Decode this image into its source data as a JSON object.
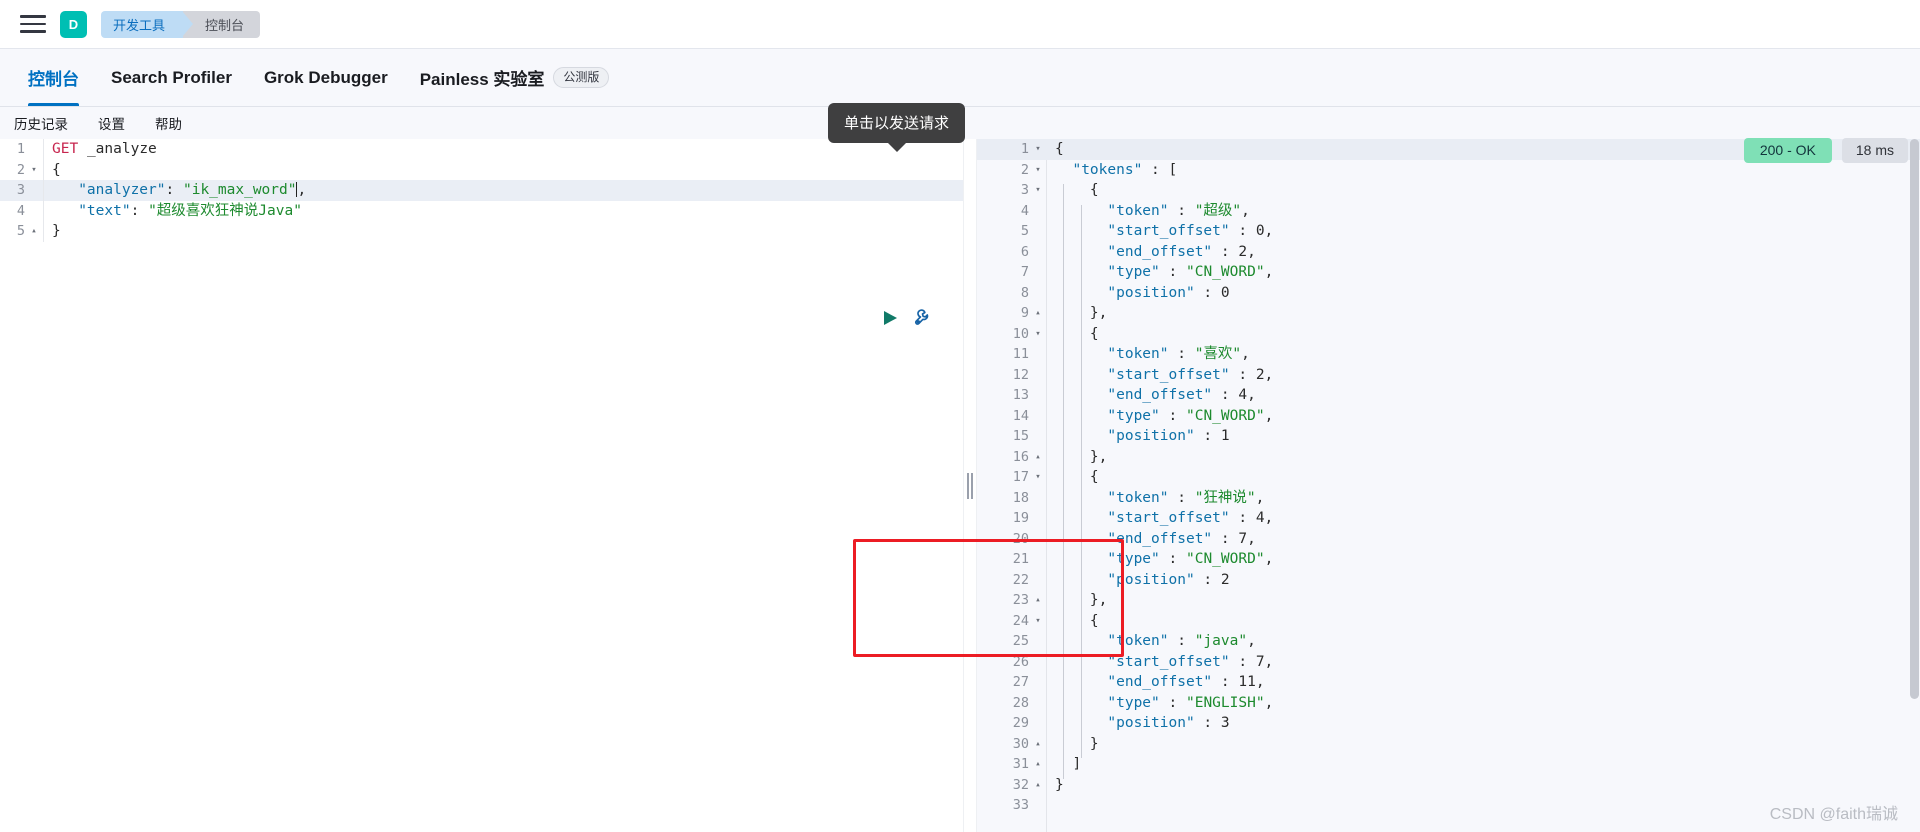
{
  "topbar": {
    "menu_icon": "hamburger-menu-icon",
    "avatar_letter": "D",
    "breadcrumb": {
      "first": "开发工具",
      "second": "控制台"
    }
  },
  "tabs": [
    {
      "label": "控制台",
      "active": true,
      "badge": ""
    },
    {
      "label": "Search Profiler",
      "active": false,
      "badge": ""
    },
    {
      "label": "Grok Debugger",
      "active": false,
      "badge": ""
    },
    {
      "label": "Painless 实验室",
      "active": false,
      "badge": "公测版"
    }
  ],
  "subnav": [
    {
      "label": "历史记录"
    },
    {
      "label": "设置"
    },
    {
      "label": "帮助"
    }
  ],
  "tooltip": {
    "text": "单击以发送请求"
  },
  "run_controls": {
    "play_icon": "play-triangle-icon",
    "wrench_icon": "wrench-icon",
    "play_color": "#117a68",
    "wrench_color": "#1763a6"
  },
  "status": {
    "code": "200 - OK",
    "time": "18 ms",
    "ok_color": "#7fe0b6",
    "time_color": "#dcdfe6"
  },
  "request_editor": {
    "highlight_line": 3,
    "lines": [
      {
        "n": 1,
        "fold": "",
        "tokens": [
          {
            "t": "method",
            "v": "GET"
          },
          {
            "t": "plain",
            "v": " "
          },
          {
            "t": "url",
            "v": "_analyze"
          }
        ]
      },
      {
        "n": 2,
        "fold": "▾",
        "tokens": [
          {
            "t": "punc",
            "v": "{"
          }
        ]
      },
      {
        "n": 3,
        "fold": "",
        "tokens": [
          {
            "t": "plain",
            "v": "   "
          },
          {
            "t": "key",
            "v": "\"analyzer\""
          },
          {
            "t": "punc",
            "v": ": "
          },
          {
            "t": "str",
            "v": "\"ik_max_word\""
          },
          {
            "t": "caret",
            "v": ""
          },
          {
            "t": "punc",
            "v": ","
          }
        ]
      },
      {
        "n": 4,
        "fold": "",
        "tokens": [
          {
            "t": "plain",
            "v": "   "
          },
          {
            "t": "key",
            "v": "\"text\""
          },
          {
            "t": "punc",
            "v": ": "
          },
          {
            "t": "str",
            "v": "\"超级喜欢狂神说Java\""
          }
        ]
      },
      {
        "n": 5,
        "fold": "▴",
        "tokens": [
          {
            "t": "punc",
            "v": "}"
          }
        ]
      }
    ]
  },
  "response_editor": {
    "lines": [
      {
        "n": 1,
        "fold": "▾",
        "indent": 0,
        "tokens": [
          {
            "t": "punc",
            "v": "{"
          }
        ]
      },
      {
        "n": 2,
        "fold": "▾",
        "indent": 0,
        "tokens": [
          {
            "t": "plain",
            "v": "  "
          },
          {
            "t": "key",
            "v": "\"tokens\""
          },
          {
            "t": "punc",
            "v": " : ["
          }
        ]
      },
      {
        "n": 3,
        "fold": "▾",
        "indent": 1,
        "tokens": [
          {
            "t": "plain",
            "v": "    "
          },
          {
            "t": "punc",
            "v": "{"
          }
        ]
      },
      {
        "n": 4,
        "fold": "",
        "indent": 2,
        "tokens": [
          {
            "t": "plain",
            "v": "      "
          },
          {
            "t": "key",
            "v": "\"token\""
          },
          {
            "t": "punc",
            "v": " : "
          },
          {
            "t": "str",
            "v": "\"超级\""
          },
          {
            "t": "punc",
            "v": ","
          }
        ]
      },
      {
        "n": 5,
        "fold": "",
        "indent": 2,
        "tokens": [
          {
            "t": "plain",
            "v": "      "
          },
          {
            "t": "key",
            "v": "\"start_offset\""
          },
          {
            "t": "punc",
            "v": " : "
          },
          {
            "t": "num",
            "v": "0"
          },
          {
            "t": "punc",
            "v": ","
          }
        ]
      },
      {
        "n": 6,
        "fold": "",
        "indent": 2,
        "tokens": [
          {
            "t": "plain",
            "v": "      "
          },
          {
            "t": "key",
            "v": "\"end_offset\""
          },
          {
            "t": "punc",
            "v": " : "
          },
          {
            "t": "num",
            "v": "2"
          },
          {
            "t": "punc",
            "v": ","
          }
        ]
      },
      {
        "n": 7,
        "fold": "",
        "indent": 2,
        "tokens": [
          {
            "t": "plain",
            "v": "      "
          },
          {
            "t": "key",
            "v": "\"type\""
          },
          {
            "t": "punc",
            "v": " : "
          },
          {
            "t": "str",
            "v": "\"CN_WORD\""
          },
          {
            "t": "punc",
            "v": ","
          }
        ]
      },
      {
        "n": 8,
        "fold": "",
        "indent": 2,
        "tokens": [
          {
            "t": "plain",
            "v": "      "
          },
          {
            "t": "key",
            "v": "\"position\""
          },
          {
            "t": "punc",
            "v": " : "
          },
          {
            "t": "num",
            "v": "0"
          }
        ]
      },
      {
        "n": 9,
        "fold": "▴",
        "indent": 1,
        "tokens": [
          {
            "t": "plain",
            "v": "    "
          },
          {
            "t": "punc",
            "v": "},"
          }
        ]
      },
      {
        "n": 10,
        "fold": "▾",
        "indent": 1,
        "tokens": [
          {
            "t": "plain",
            "v": "    "
          },
          {
            "t": "punc",
            "v": "{"
          }
        ]
      },
      {
        "n": 11,
        "fold": "",
        "indent": 2,
        "tokens": [
          {
            "t": "plain",
            "v": "      "
          },
          {
            "t": "key",
            "v": "\"token\""
          },
          {
            "t": "punc",
            "v": " : "
          },
          {
            "t": "str",
            "v": "\"喜欢\""
          },
          {
            "t": "punc",
            "v": ","
          }
        ]
      },
      {
        "n": 12,
        "fold": "",
        "indent": 2,
        "tokens": [
          {
            "t": "plain",
            "v": "      "
          },
          {
            "t": "key",
            "v": "\"start_offset\""
          },
          {
            "t": "punc",
            "v": " : "
          },
          {
            "t": "num",
            "v": "2"
          },
          {
            "t": "punc",
            "v": ","
          }
        ]
      },
      {
        "n": 13,
        "fold": "",
        "indent": 2,
        "tokens": [
          {
            "t": "plain",
            "v": "      "
          },
          {
            "t": "key",
            "v": "\"end_offset\""
          },
          {
            "t": "punc",
            "v": " : "
          },
          {
            "t": "num",
            "v": "4"
          },
          {
            "t": "punc",
            "v": ","
          }
        ]
      },
      {
        "n": 14,
        "fold": "",
        "indent": 2,
        "tokens": [
          {
            "t": "plain",
            "v": "      "
          },
          {
            "t": "key",
            "v": "\"type\""
          },
          {
            "t": "punc",
            "v": " : "
          },
          {
            "t": "str",
            "v": "\"CN_WORD\""
          },
          {
            "t": "punc",
            "v": ","
          }
        ]
      },
      {
        "n": 15,
        "fold": "",
        "indent": 2,
        "tokens": [
          {
            "t": "plain",
            "v": "      "
          },
          {
            "t": "key",
            "v": "\"position\""
          },
          {
            "t": "punc",
            "v": " : "
          },
          {
            "t": "num",
            "v": "1"
          }
        ]
      },
      {
        "n": 16,
        "fold": "▴",
        "indent": 1,
        "tokens": [
          {
            "t": "plain",
            "v": "    "
          },
          {
            "t": "punc",
            "v": "},"
          }
        ]
      },
      {
        "n": 17,
        "fold": "▾",
        "indent": 1,
        "tokens": [
          {
            "t": "plain",
            "v": "    "
          },
          {
            "t": "punc",
            "v": "{"
          }
        ]
      },
      {
        "n": 18,
        "fold": "",
        "indent": 2,
        "tokens": [
          {
            "t": "plain",
            "v": "      "
          },
          {
            "t": "key",
            "v": "\"token\""
          },
          {
            "t": "punc",
            "v": " : "
          },
          {
            "t": "str",
            "v": "\"狂神说\""
          },
          {
            "t": "punc",
            "v": ","
          }
        ]
      },
      {
        "n": 19,
        "fold": "",
        "indent": 2,
        "tokens": [
          {
            "t": "plain",
            "v": "      "
          },
          {
            "t": "key",
            "v": "\"start_offset\""
          },
          {
            "t": "punc",
            "v": " : "
          },
          {
            "t": "num",
            "v": "4"
          },
          {
            "t": "punc",
            "v": ","
          }
        ]
      },
      {
        "n": 20,
        "fold": "",
        "indent": 2,
        "tokens": [
          {
            "t": "plain",
            "v": "      "
          },
          {
            "t": "key",
            "v": "\"end_offset\""
          },
          {
            "t": "punc",
            "v": " : "
          },
          {
            "t": "num",
            "v": "7"
          },
          {
            "t": "punc",
            "v": ","
          }
        ]
      },
      {
        "n": 21,
        "fold": "",
        "indent": 2,
        "tokens": [
          {
            "t": "plain",
            "v": "      "
          },
          {
            "t": "key",
            "v": "\"type\""
          },
          {
            "t": "punc",
            "v": " : "
          },
          {
            "t": "str",
            "v": "\"CN_WORD\""
          },
          {
            "t": "punc",
            "v": ","
          }
        ]
      },
      {
        "n": 22,
        "fold": "",
        "indent": 2,
        "tokens": [
          {
            "t": "plain",
            "v": "      "
          },
          {
            "t": "key",
            "v": "\"position\""
          },
          {
            "t": "punc",
            "v": " : "
          },
          {
            "t": "num",
            "v": "2"
          }
        ]
      },
      {
        "n": 23,
        "fold": "▴",
        "indent": 1,
        "tokens": [
          {
            "t": "plain",
            "v": "    "
          },
          {
            "t": "punc",
            "v": "},"
          }
        ]
      },
      {
        "n": 24,
        "fold": "▾",
        "indent": 1,
        "tokens": [
          {
            "t": "plain",
            "v": "    "
          },
          {
            "t": "punc",
            "v": "{"
          }
        ]
      },
      {
        "n": 25,
        "fold": "",
        "indent": 2,
        "tokens": [
          {
            "t": "plain",
            "v": "      "
          },
          {
            "t": "key",
            "v": "\"token\""
          },
          {
            "t": "punc",
            "v": " : "
          },
          {
            "t": "str",
            "v": "\"java\""
          },
          {
            "t": "punc",
            "v": ","
          }
        ]
      },
      {
        "n": 26,
        "fold": "",
        "indent": 2,
        "tokens": [
          {
            "t": "plain",
            "v": "      "
          },
          {
            "t": "key",
            "v": "\"start_offset\""
          },
          {
            "t": "punc",
            "v": " : "
          },
          {
            "t": "num",
            "v": "7"
          },
          {
            "t": "punc",
            "v": ","
          }
        ]
      },
      {
        "n": 27,
        "fold": "",
        "indent": 2,
        "tokens": [
          {
            "t": "plain",
            "v": "      "
          },
          {
            "t": "key",
            "v": "\"end_offset\""
          },
          {
            "t": "punc",
            "v": " : "
          },
          {
            "t": "num",
            "v": "11"
          },
          {
            "t": "punc",
            "v": ","
          }
        ]
      },
      {
        "n": 28,
        "fold": "",
        "indent": 2,
        "tokens": [
          {
            "t": "plain",
            "v": "      "
          },
          {
            "t": "key",
            "v": "\"type\""
          },
          {
            "t": "punc",
            "v": " : "
          },
          {
            "t": "str",
            "v": "\"ENGLISH\""
          },
          {
            "t": "punc",
            "v": ","
          }
        ]
      },
      {
        "n": 29,
        "fold": "",
        "indent": 2,
        "tokens": [
          {
            "t": "plain",
            "v": "      "
          },
          {
            "t": "key",
            "v": "\"position\""
          },
          {
            "t": "punc",
            "v": " : "
          },
          {
            "t": "num",
            "v": "3"
          }
        ]
      },
      {
        "n": 30,
        "fold": "▴",
        "indent": 1,
        "tokens": [
          {
            "t": "plain",
            "v": "    "
          },
          {
            "t": "punc",
            "v": "}"
          }
        ]
      },
      {
        "n": 31,
        "fold": "▴",
        "indent": 0,
        "tokens": [
          {
            "t": "plain",
            "v": "  "
          },
          {
            "t": "punc",
            "v": "]"
          }
        ]
      },
      {
        "n": 32,
        "fold": "▴",
        "indent": 0,
        "tokens": [
          {
            "t": "punc",
            "v": "}"
          }
        ]
      },
      {
        "n": 33,
        "fold": "",
        "indent": 0,
        "tokens": [
          {
            "t": "plain",
            "v": ""
          }
        ]
      }
    ]
  },
  "annotation": {
    "red_box_color": "#ec1c24",
    "covers_lines": "17-23"
  },
  "watermark": {
    "text": "CSDN @faith瑞诚"
  }
}
